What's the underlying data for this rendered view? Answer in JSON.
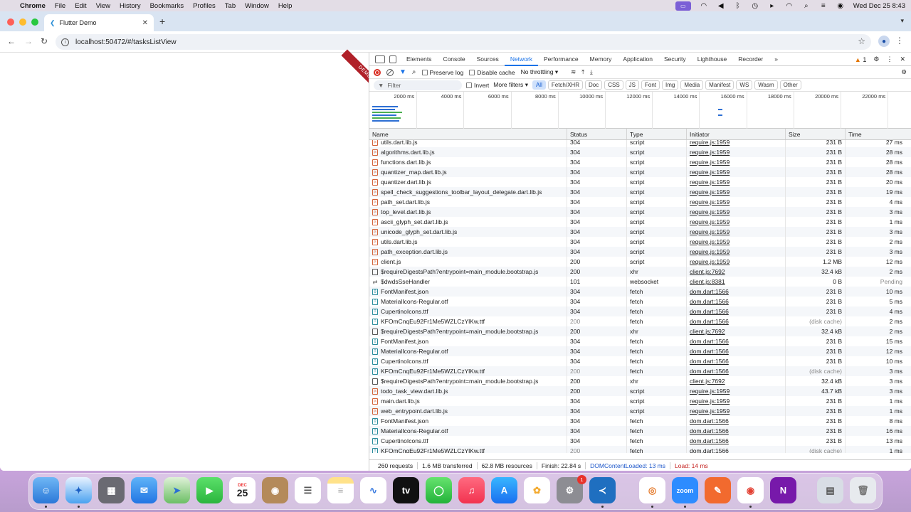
{
  "menubar": {
    "app": "Chrome",
    "items": [
      "File",
      "Edit",
      "View",
      "History",
      "Bookmarks",
      "Profiles",
      "Tab",
      "Window",
      "Help"
    ],
    "clock": "Wed Dec 25  8:43"
  },
  "browser": {
    "tab_title": "Flutter Demo",
    "url": "localhost:50472/#/tasksListView",
    "debug_banner": "DEMO"
  },
  "devtools": {
    "tabs": [
      "Elements",
      "Console",
      "Sources",
      "Network",
      "Performance",
      "Memory",
      "Application",
      "Security",
      "Lighthouse",
      "Recorder"
    ],
    "active_tab": "Network",
    "more_tabs": "»",
    "warning_count": "1",
    "controls": {
      "preserve_log": "Preserve log",
      "disable_cache": "Disable cache",
      "throttling": "No throttling"
    },
    "filter": {
      "placeholder": "Filter",
      "invert": "Invert",
      "more_filters": "More filters",
      "chips": [
        "All",
        "Fetch/XHR",
        "Doc",
        "CSS",
        "JS",
        "Font",
        "Img",
        "Media",
        "Manifest",
        "WS",
        "Wasm",
        "Other"
      ]
    },
    "overview_ticks": [
      "2000 ms",
      "4000 ms",
      "6000 ms",
      "8000 ms",
      "10000 ms",
      "12000 ms",
      "14000 ms",
      "16000 ms",
      "18000 ms",
      "20000 ms",
      "22000 ms"
    ],
    "columns": [
      "Name",
      "Status",
      "Type",
      "Initiator",
      "Size",
      "Time"
    ],
    "rows": [
      {
        "name": "utils.dart.lib.js",
        "status": "304",
        "type": "script",
        "initiator": "require.js:1959",
        "size": "231 B",
        "time": "27 ms",
        "icon": "js"
      },
      {
        "name": "algorithms.dart.lib.js",
        "status": "304",
        "type": "script",
        "initiator": "require.js:1959",
        "size": "231 B",
        "time": "28 ms",
        "icon": "js"
      },
      {
        "name": "functions.dart.lib.js",
        "status": "304",
        "type": "script",
        "initiator": "require.js:1959",
        "size": "231 B",
        "time": "28 ms",
        "icon": "js"
      },
      {
        "name": "quantizer_map.dart.lib.js",
        "status": "304",
        "type": "script",
        "initiator": "require.js:1959",
        "size": "231 B",
        "time": "28 ms",
        "icon": "js"
      },
      {
        "name": "quantizer.dart.lib.js",
        "status": "304",
        "type": "script",
        "initiator": "require.js:1959",
        "size": "231 B",
        "time": "20 ms",
        "icon": "js"
      },
      {
        "name": "spell_check_suggestions_toolbar_layout_delegate.dart.lib.js",
        "status": "304",
        "type": "script",
        "initiator": "require.js:1959",
        "size": "231 B",
        "time": "19 ms",
        "icon": "js"
      },
      {
        "name": "path_set.dart.lib.js",
        "status": "304",
        "type": "script",
        "initiator": "require.js:1959",
        "size": "231 B",
        "time": "4 ms",
        "icon": "js"
      },
      {
        "name": "top_level.dart.lib.js",
        "status": "304",
        "type": "script",
        "initiator": "require.js:1959",
        "size": "231 B",
        "time": "3 ms",
        "icon": "js"
      },
      {
        "name": "ascii_glyph_set.dart.lib.js",
        "status": "304",
        "type": "script",
        "initiator": "require.js:1959",
        "size": "231 B",
        "time": "1 ms",
        "icon": "js"
      },
      {
        "name": "unicode_glyph_set.dart.lib.js",
        "status": "304",
        "type": "script",
        "initiator": "require.js:1959",
        "size": "231 B",
        "time": "3 ms",
        "icon": "js"
      },
      {
        "name": "utils.dart.lib.js",
        "status": "304",
        "type": "script",
        "initiator": "require.js:1959",
        "size": "231 B",
        "time": "2 ms",
        "icon": "js"
      },
      {
        "name": "path_exception.dart.lib.js",
        "status": "304",
        "type": "script",
        "initiator": "require.js:1959",
        "size": "231 B",
        "time": "3 ms",
        "icon": "js"
      },
      {
        "name": "client.js",
        "status": "200",
        "type": "script",
        "initiator": "require.js:1959",
        "size": "1.2 MB",
        "time": "12 ms",
        "icon": "js"
      },
      {
        "name": "$requireDigestsPath?entrypoint=main_module.bootstrap.js",
        "status": "200",
        "type": "xhr",
        "initiator": "client.js:7692",
        "size": "32.4 kB",
        "time": "2 ms",
        "icon": "xhr"
      },
      {
        "name": "$dwdsSseHandler",
        "status": "101",
        "type": "websocket",
        "initiator": "client.js:8381",
        "size": "0 B",
        "time": "Pending",
        "icon": "ws"
      },
      {
        "name": "FontManifest.json",
        "status": "304",
        "type": "fetch",
        "initiator": "dom.dart:1566",
        "size": "231 B",
        "time": "10 ms",
        "icon": "fetch"
      },
      {
        "name": "MaterialIcons-Regular.otf",
        "status": "304",
        "type": "fetch",
        "initiator": "dom.dart:1566",
        "size": "231 B",
        "time": "5 ms",
        "icon": "font"
      },
      {
        "name": "CupertinoIcons.ttf",
        "status": "304",
        "type": "fetch",
        "initiator": "dom.dart:1566",
        "size": "231 B",
        "time": "4 ms",
        "icon": "font"
      },
      {
        "name": "KFOmCnqEu92Fr1Me5WZLCzYlKw.ttf",
        "status": "200",
        "type": "fetch",
        "initiator": "dom.dart:1566",
        "size": "(disk cache)",
        "time": "2 ms",
        "icon": "font"
      },
      {
        "name": "$requireDigestsPath?entrypoint=main_module.bootstrap.js",
        "status": "200",
        "type": "xhr",
        "initiator": "client.js:7692",
        "size": "32.4 kB",
        "time": "2 ms",
        "icon": "xhr"
      },
      {
        "name": "FontManifest.json",
        "status": "304",
        "type": "fetch",
        "initiator": "dom.dart:1566",
        "size": "231 B",
        "time": "15 ms",
        "icon": "fetch"
      },
      {
        "name": "MaterialIcons-Regular.otf",
        "status": "304",
        "type": "fetch",
        "initiator": "dom.dart:1566",
        "size": "231 B",
        "time": "12 ms",
        "icon": "font"
      },
      {
        "name": "CupertinoIcons.ttf",
        "status": "304",
        "type": "fetch",
        "initiator": "dom.dart:1566",
        "size": "231 B",
        "time": "10 ms",
        "icon": "font"
      },
      {
        "name": "KFOmCnqEu92Fr1Me5WZLCzYlKw.ttf",
        "status": "200",
        "type": "fetch",
        "initiator": "dom.dart:1566",
        "size": "(disk cache)",
        "time": "3 ms",
        "icon": "font"
      },
      {
        "name": "$requireDigestsPath?entrypoint=main_module.bootstrap.js",
        "status": "200",
        "type": "xhr",
        "initiator": "client.js:7692",
        "size": "32.4 kB",
        "time": "3 ms",
        "icon": "xhr"
      },
      {
        "name": "todo_task_view.dart.lib.js",
        "status": "200",
        "type": "script",
        "initiator": "require.js:1959",
        "size": "43.7 kB",
        "time": "3 ms",
        "icon": "js"
      },
      {
        "name": "main.dart.lib.js",
        "status": "304",
        "type": "script",
        "initiator": "require.js:1959",
        "size": "231 B",
        "time": "1 ms",
        "icon": "js"
      },
      {
        "name": "web_entrypoint.dart.lib.js",
        "status": "304",
        "type": "script",
        "initiator": "require.js:1959",
        "size": "231 B",
        "time": "1 ms",
        "icon": "js"
      },
      {
        "name": "FontManifest.json",
        "status": "304",
        "type": "fetch",
        "initiator": "dom.dart:1566",
        "size": "231 B",
        "time": "8 ms",
        "icon": "fetch"
      },
      {
        "name": "MaterialIcons-Regular.otf",
        "status": "304",
        "type": "fetch",
        "initiator": "dom.dart:1566",
        "size": "231 B",
        "time": "16 ms",
        "icon": "font"
      },
      {
        "name": "CupertinoIcons.ttf",
        "status": "304",
        "type": "fetch",
        "initiator": "dom.dart:1566",
        "size": "231 B",
        "time": "13 ms",
        "icon": "font"
      },
      {
        "name": "KFOmCnqEu92Fr1Me5WZLCzYlKw.ttf",
        "status": "200",
        "type": "fetch",
        "initiator": "dom.dart:1566",
        "size": "(disk cache)",
        "time": "1 ms",
        "icon": "font"
      }
    ],
    "summary": {
      "requests": "260 requests",
      "transferred": "1.6 MB transferred",
      "resources": "62.8 MB resources",
      "finish": "Finish: 22.84 s",
      "domcontentloaded": "DOMContentLoaded: 13 ms",
      "load": "Load: 14 ms"
    }
  },
  "dock": {
    "calendar_month": "DEC",
    "calendar_day": "25",
    "settings_badge": "1",
    "zoom_label": "zoom",
    "onenote_label": "N"
  }
}
